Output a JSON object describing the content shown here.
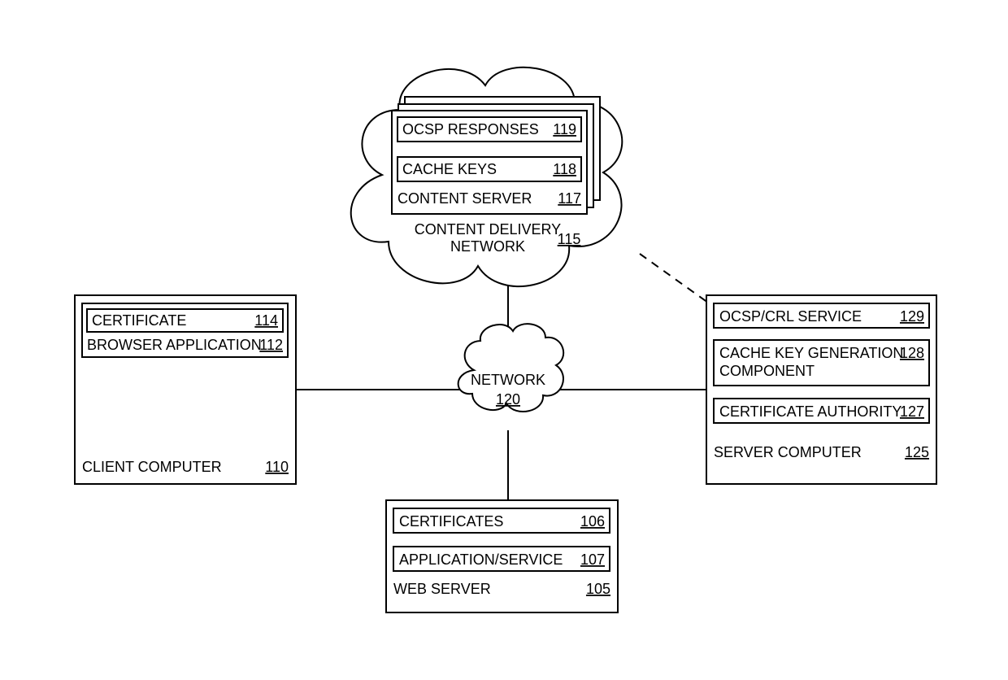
{
  "network": {
    "label": "NETWORK",
    "num": "120"
  },
  "cdn": {
    "label1": "CONTENT DELIVERY",
    "label2": "NETWORK",
    "num": "115",
    "content_server": {
      "label": "CONTENT SERVER",
      "num": "117"
    },
    "cache_keys": {
      "label": "CACHE KEYS",
      "num": "118"
    },
    "ocsp_responses": {
      "label": "OCSP RESPONSES",
      "num": "119"
    }
  },
  "client": {
    "label": "CLIENT COMPUTER",
    "num": "110",
    "browser": {
      "label": "BROWSER APPLICATION",
      "num": "112"
    },
    "certificate": {
      "label": "CERTIFICATE",
      "num": "114"
    }
  },
  "webserver": {
    "label": "WEB SERVER",
    "num": "105",
    "certificates": {
      "label": "CERTIFICATES",
      "num": "106"
    },
    "app": {
      "label": "APPLICATION/SERVICE",
      "num": "107"
    }
  },
  "server": {
    "label": "SERVER COMPUTER",
    "num": "125",
    "ca": {
      "label": "CERTIFICATE AUTHORITY",
      "num": "127"
    },
    "cachegen": {
      "label1": "CACHE KEY GENERATION",
      "label2": "COMPONENT",
      "num": "128"
    },
    "ocspcrl": {
      "label": "OCSP/CRL SERVICE",
      "num": "129"
    }
  }
}
